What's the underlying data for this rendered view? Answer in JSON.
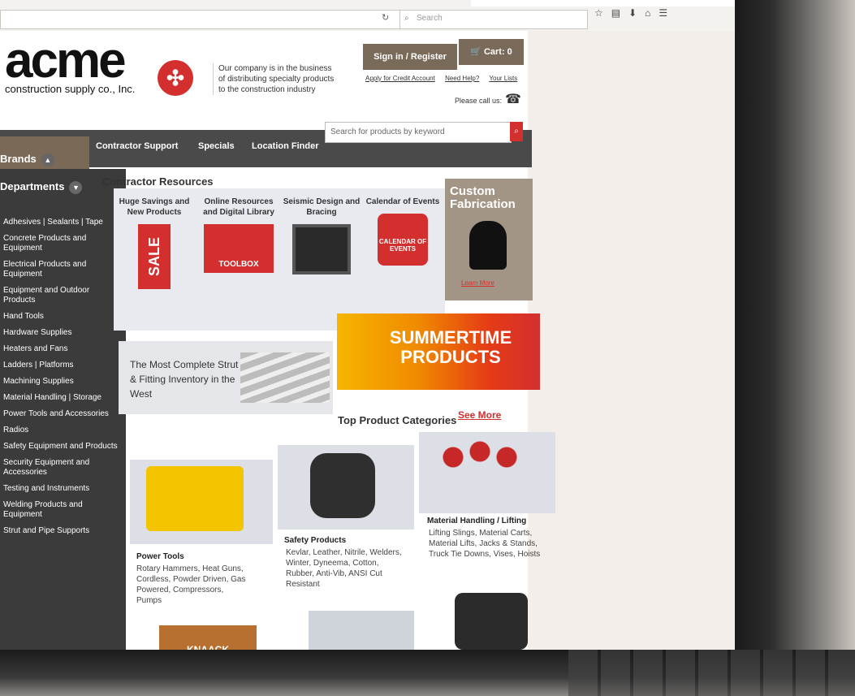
{
  "browser": {
    "search_placeholder": "Search"
  },
  "header": {
    "logo_text": "acme",
    "logo_subtext": "construction supply co., Inc.",
    "tagline": "Our company is in the business of distributing specialty products to the construction industry",
    "signin_label": "Sign in / Register",
    "cart_label": "Cart: 0",
    "links": [
      "Apply for Credit Account",
      "Need Help?",
      "Your Lists"
    ],
    "call_label": "Please call us:"
  },
  "nav": {
    "brands_label": "Brands",
    "departments_label": "Departments",
    "items": [
      "Contractor Support",
      "Specials",
      "Location Finder"
    ],
    "search_placeholder": "Search for products by keyword"
  },
  "sidebar": {
    "items": [
      "Adhesives | Sealants | Tape",
      "Concrete Products and Equipment",
      "Electrical Products and Equipment",
      "Equipment and Outdoor Products",
      "Hand Tools",
      "Hardware Supplies",
      "Heaters and Fans",
      "Ladders | Platforms",
      "Machining Supplies",
      "Material Handling | Storage",
      "Power Tools and Accessories",
      "Radios",
      "Safety Equipment and Products",
      "Security Equipment and Accessories",
      "Testing and Instruments",
      "Welding Products and Equipment",
      "Strut and Pipe Supports"
    ]
  },
  "resources": {
    "title": "Contractor Resources",
    "cards": [
      {
        "title": "Huge Savings and New Products",
        "badge": "SALE"
      },
      {
        "title": "Online Resources and Digital Library",
        "badge": "TOOLBOX"
      },
      {
        "title": "Seismic Design and Bracing"
      },
      {
        "title": "Calendar of Events",
        "badge": "CALENDAR OF EVENTS"
      }
    ],
    "custom": {
      "title": "Custom Fabrication",
      "link": "Learn More"
    }
  },
  "banners": {
    "strut": "The Most Complete Strut & Fitting Inventory in the West",
    "summer": "SUMMERTIME PRODUCTS"
  },
  "categories": {
    "title": "Top Product Categories",
    "see_more": "See More",
    "items": [
      {
        "title": "Power Tools",
        "desc": "Rotary Hammers, Heat Guns, Cordless, Powder Driven, Gas Powered, Compressors, Pumps"
      },
      {
        "title": "Safety Products",
        "desc": "Kevlar, Leather, Nitrile, Welders, Winter, Dyneema, Cotton, Rubber, Anti-Vib, ANSI Cut Resistant"
      },
      {
        "title": "Material Handling / Lifting",
        "desc": "Lifting Slings, Material Carts, Material Lifts, Jacks & Stands, Truck Tie Downs, Vises, Hoists"
      }
    ],
    "box_brand": "KNAACK"
  }
}
